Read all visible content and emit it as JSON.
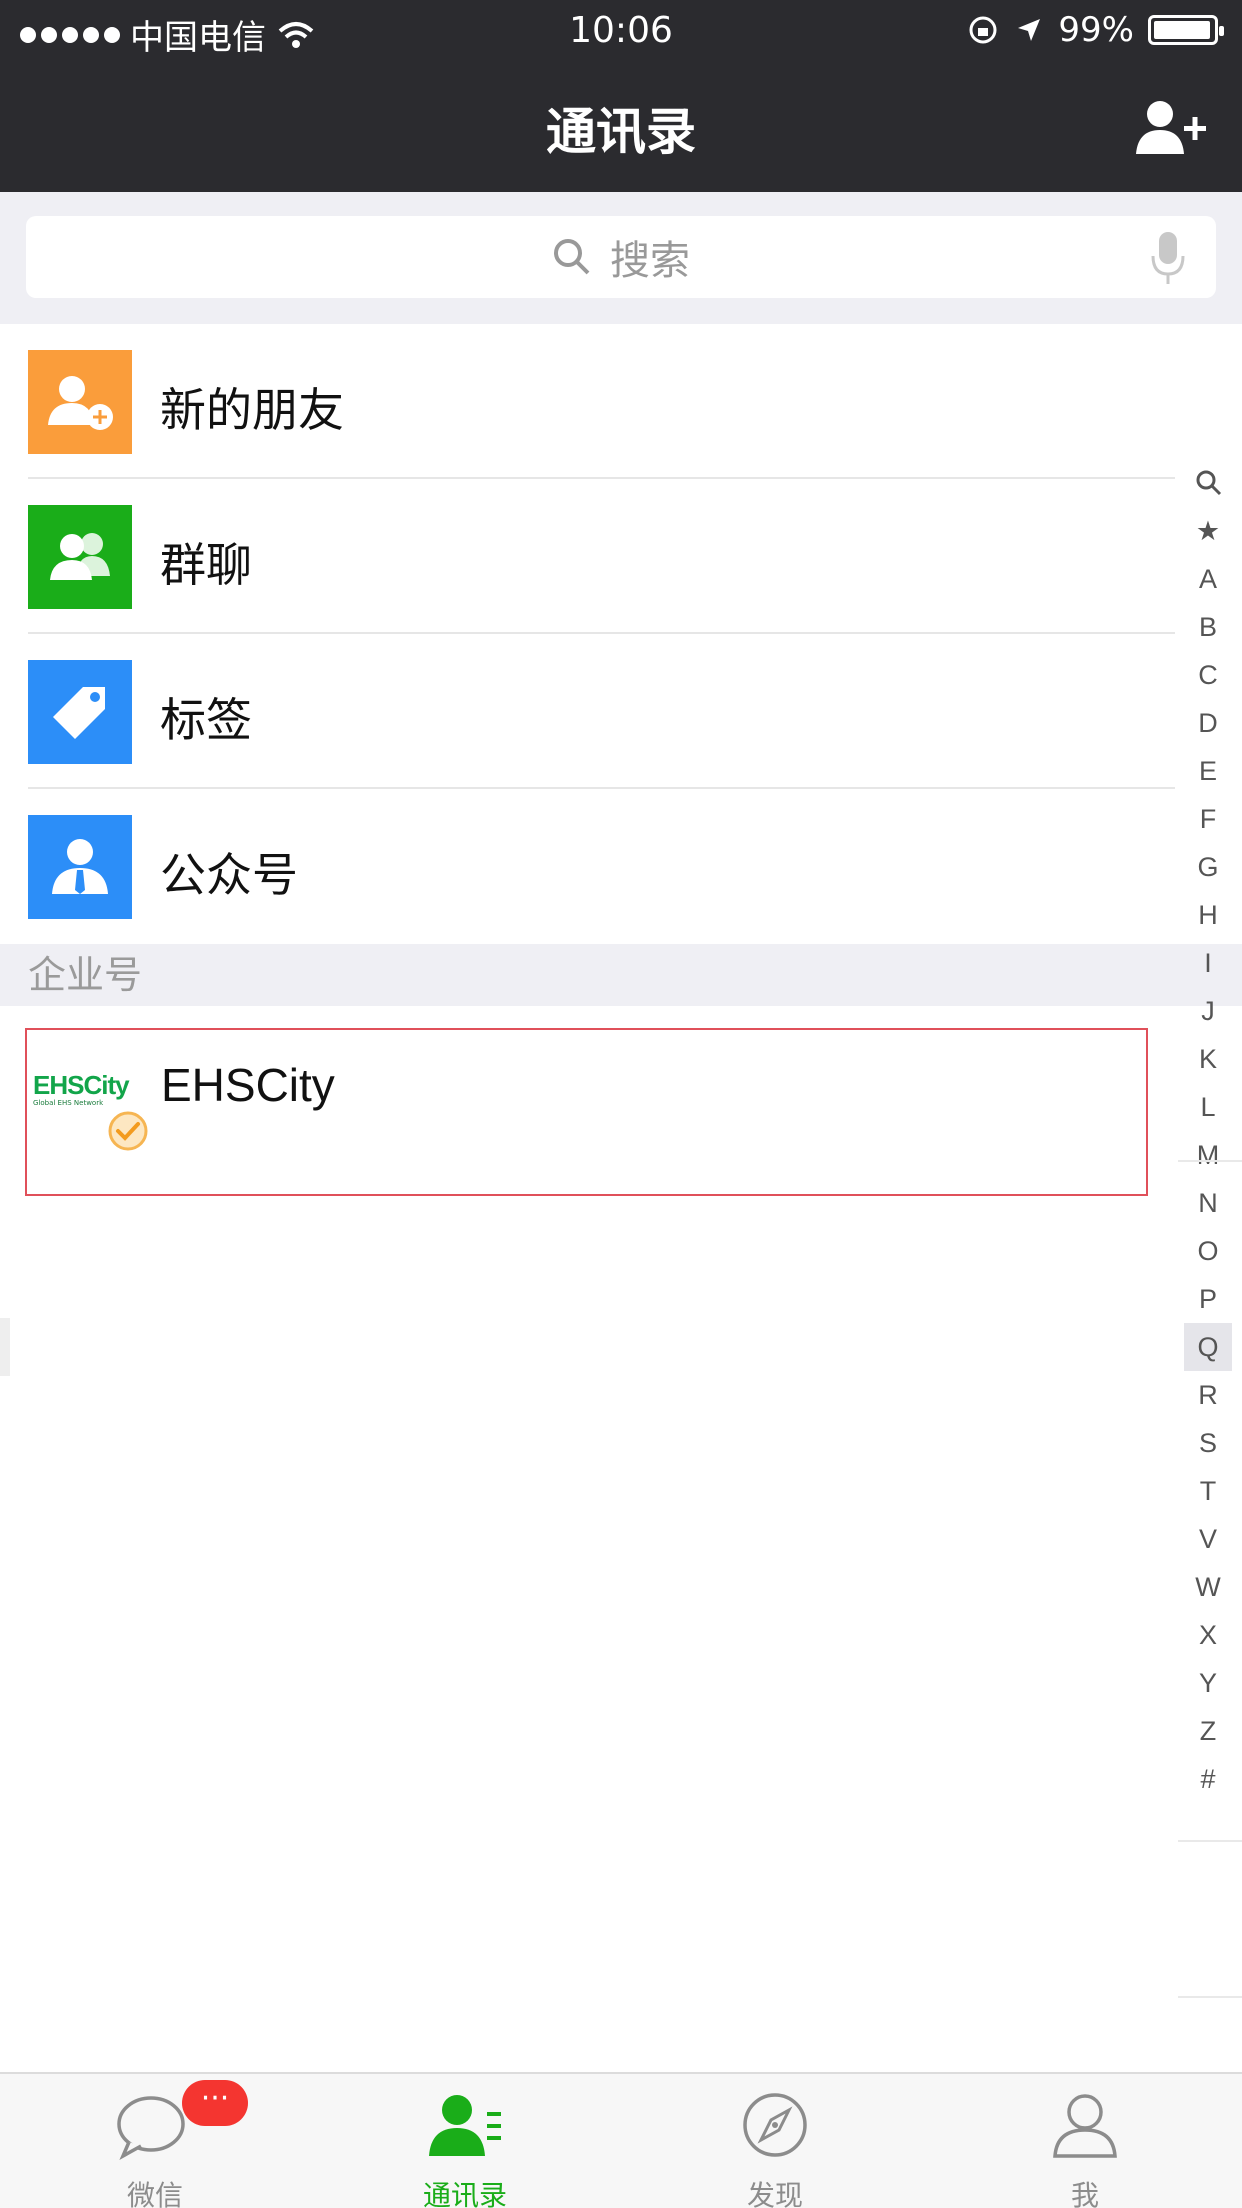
{
  "status_bar": {
    "carrier": "中国电信",
    "time": "10:06",
    "battery": "99%"
  },
  "nav": {
    "title": "通讯录"
  },
  "search": {
    "placeholder": "搜索"
  },
  "menu": {
    "items": [
      {
        "label": "新的朋友",
        "icon": "new-friend-icon",
        "color": "#fa9d3b"
      },
      {
        "label": "群聊",
        "icon": "group-chat-icon",
        "color": "#1aad19"
      },
      {
        "label": "标签",
        "icon": "tag-icon",
        "color": "#2c8ef8"
      },
      {
        "label": "公众号",
        "icon": "official-account-icon",
        "color": "#2c8ef8"
      }
    ]
  },
  "section": {
    "title": "企业号"
  },
  "enterprise": {
    "name": "EHSCity",
    "logo_text": "EHSCity",
    "logo_sub": "Global EHS Network"
  },
  "index": {
    "letters": [
      "★",
      "A",
      "B",
      "C",
      "D",
      "E",
      "F",
      "G",
      "H",
      "I",
      "J",
      "K",
      "L",
      "M",
      "N",
      "O",
      "P",
      "Q",
      "R",
      "S",
      "T",
      "V",
      "W",
      "X",
      "Y",
      "Z",
      "#"
    ],
    "active": "Q"
  },
  "tabs": [
    {
      "label": "微信",
      "icon": "chat-icon",
      "badge": "···"
    },
    {
      "label": "通讯录",
      "icon": "contacts-icon",
      "active": true
    },
    {
      "label": "发现",
      "icon": "discover-compass-icon"
    },
    {
      "label": "我",
      "icon": "me-person-icon"
    }
  ],
  "colors": {
    "accent": "#1aad19",
    "nav_bg": "#2b2b2f",
    "badge": "#f43530"
  }
}
